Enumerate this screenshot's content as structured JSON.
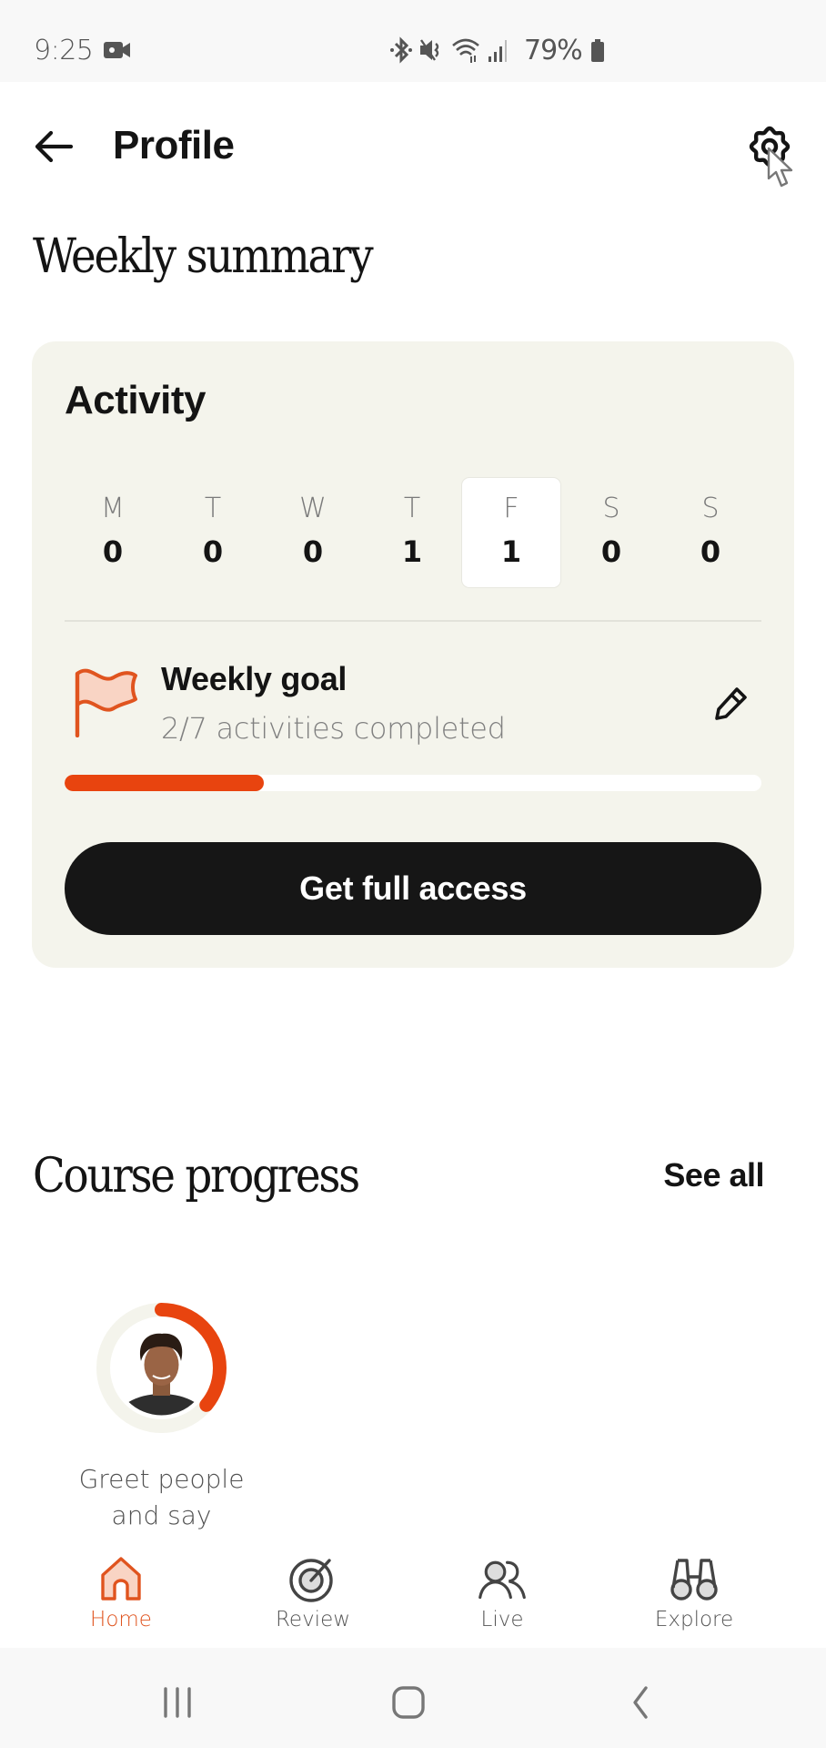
{
  "status_bar": {
    "time": "9:25",
    "battery": "79%",
    "icons": [
      "video-camera-icon",
      "bluetooth-icon",
      "mute-icon",
      "wifi-icon",
      "signal-icon",
      "battery-icon"
    ]
  },
  "header": {
    "back_icon": "arrow-left-icon",
    "title": "Profile",
    "settings_icon": "gear-icon"
  },
  "weekly_summary": {
    "title": "Weekly summary",
    "card": {
      "title": "Activity",
      "days": [
        {
          "letter": "M",
          "count": "0",
          "today": false
        },
        {
          "letter": "T",
          "count": "0",
          "today": false
        },
        {
          "letter": "W",
          "count": "0",
          "today": false
        },
        {
          "letter": "T",
          "count": "1",
          "today": false
        },
        {
          "letter": "F",
          "count": "1",
          "today": true
        },
        {
          "letter": "S",
          "count": "0",
          "today": false
        },
        {
          "letter": "S",
          "count": "0",
          "today": false
        }
      ],
      "goal": {
        "icon": "flag-icon",
        "title": "Weekly goal",
        "subtitle": "2/7 activities completed",
        "completed": 2,
        "total": 7,
        "progress_fraction": 0.2857,
        "edit_icon": "pencil-icon"
      },
      "cta_label": "Get full access"
    }
  },
  "course_progress": {
    "title": "Course progress",
    "see_all_label": "See all",
    "courses": [
      {
        "caption": "Greet people and say",
        "progress_fraction": 0.36
      }
    ]
  },
  "bottom_nav": {
    "items": [
      {
        "label": "Home",
        "icon": "home-icon",
        "active": true
      },
      {
        "label": "Review",
        "icon": "target-icon",
        "active": false
      },
      {
        "label": "Live",
        "icon": "people-icon",
        "active": false
      },
      {
        "label": "Explore",
        "icon": "binoculars-icon",
        "active": false
      }
    ]
  },
  "system_nav": {
    "buttons": [
      "recent-apps-icon",
      "home-button-icon",
      "back-chevron-icon"
    ]
  },
  "colors": {
    "accent": "#e8440f",
    "card_bg": "#f4f4ec",
    "button_bg": "#161616",
    "active_nav": "#e0541f"
  }
}
